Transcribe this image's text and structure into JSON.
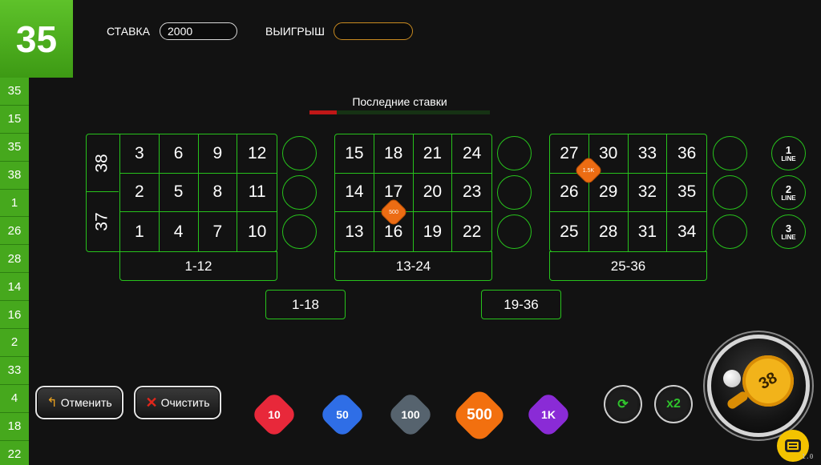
{
  "last_result": "35",
  "history": [
    "35",
    "15",
    "35",
    "38",
    "1",
    "26",
    "28",
    "14",
    "16",
    "2",
    "33",
    "4",
    "18",
    "22"
  ],
  "top_bar": {
    "bet_label": "СТАВКА",
    "bet_value": "2000",
    "win_label": "ВЫИГРЫШ",
    "win_value": ""
  },
  "last_bets": {
    "title": "Последние ставки",
    "progress": 0.15
  },
  "zeros": [
    "38",
    "37"
  ],
  "grids": [
    [
      "3",
      "6",
      "9",
      "12",
      "2",
      "5",
      "8",
      "11",
      "1",
      "4",
      "7",
      "10"
    ],
    [
      "15",
      "18",
      "21",
      "24",
      "14",
      "17",
      "20",
      "23",
      "13",
      "16",
      "19",
      "22"
    ],
    [
      "27",
      "30",
      "33",
      "36",
      "26",
      "29",
      "32",
      "35",
      "25",
      "28",
      "31",
      "34"
    ]
  ],
  "dozens": [
    "1-12",
    "13-24",
    "25-36"
  ],
  "halves": [
    "1-18",
    "19-36"
  ],
  "lines": [
    {
      "number": "1",
      "label": "LINE"
    },
    {
      "number": "2",
      "label": "LINE"
    },
    {
      "number": "3",
      "label": "LINE"
    }
  ],
  "placed_chips": [
    "500",
    "1.5K"
  ],
  "buttons": {
    "undo": "Отменить",
    "clear": "Очистить",
    "double": "x2",
    "spin_chip": "38"
  },
  "chips": [
    {
      "label": "10",
      "color": "#e8283a"
    },
    {
      "label": "50",
      "color": "#2f6ee6"
    },
    {
      "label": "100",
      "color": "#56636e"
    },
    {
      "label": "500",
      "color": "#f2700f"
    },
    {
      "label": "1K",
      "color": "#8a2bd6"
    }
  ],
  "colors": {
    "accent": "#27c21c",
    "history_bg": "#46a81d",
    "win_border": "#c88a20",
    "progress": "#c01717",
    "chat": "#f3c300"
  },
  "version": "1.0"
}
